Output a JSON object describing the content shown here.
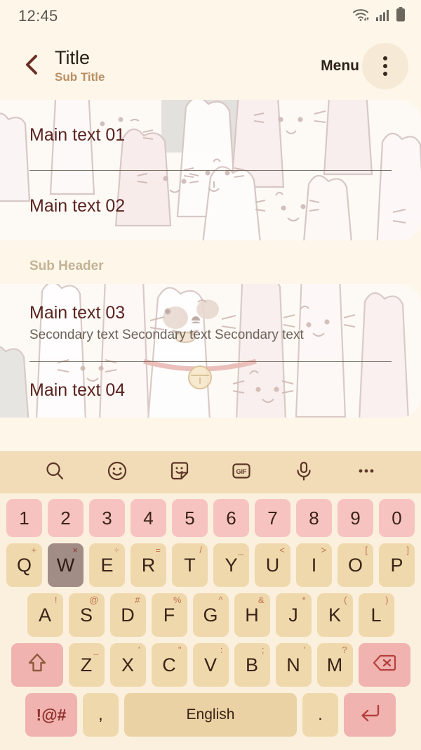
{
  "status_bar": {
    "time": "12:45",
    "icons": [
      "wifi-icon",
      "signal-icon",
      "battery-icon"
    ]
  },
  "app_bar": {
    "back_icon": "back-chevron-icon",
    "title": "Title",
    "subtitle": "Sub Title",
    "menu_label": "Menu",
    "overflow_icon": "overflow-menu-icon"
  },
  "content": {
    "card_one": {
      "rows": [
        {
          "main": "Main text 01"
        },
        {
          "main": "Main text 02"
        }
      ]
    },
    "sub_header": "Sub Header",
    "card_two": {
      "rows": [
        {
          "main": "Main text 03",
          "secondary": "Secondary text Secondary text Secondary text"
        },
        {
          "main": "Main text 04"
        }
      ]
    }
  },
  "keyboard": {
    "toolbar": [
      {
        "name": "search-icon",
        "label": ""
      },
      {
        "name": "emoji-icon",
        "label": ""
      },
      {
        "name": "sticker-icon",
        "label": ""
      },
      {
        "name": "gif-icon",
        "label": "GIF"
      },
      {
        "name": "microphone-icon",
        "label": ""
      },
      {
        "name": "more-options-icon",
        "label": ""
      }
    ],
    "rows": {
      "numbers": [
        "1",
        "2",
        "3",
        "4",
        "5",
        "6",
        "7",
        "8",
        "9",
        "0"
      ],
      "row_q": [
        {
          "key": "Q",
          "sup": "+"
        },
        {
          "key": "W",
          "sup": "×",
          "pressed": true
        },
        {
          "key": "E",
          "sup": "÷"
        },
        {
          "key": "R",
          "sup": "="
        },
        {
          "key": "T",
          "sup": "/"
        },
        {
          "key": "Y",
          "sup": "_"
        },
        {
          "key": "U",
          "sup": "<"
        },
        {
          "key": "I",
          "sup": ">"
        },
        {
          "key": "O",
          "sup": "["
        },
        {
          "key": "P",
          "sup": "]"
        }
      ],
      "row_a": [
        {
          "key": "A",
          "sup": "!"
        },
        {
          "key": "S",
          "sup": "@"
        },
        {
          "key": "D",
          "sup": "#"
        },
        {
          "key": "F",
          "sup": "%"
        },
        {
          "key": "G",
          "sup": "^"
        },
        {
          "key": "H",
          "sup": "&"
        },
        {
          "key": "J",
          "sup": "*"
        },
        {
          "key": "K",
          "sup": "("
        },
        {
          "key": "L",
          "sup": ")"
        }
      ],
      "row_z": [
        {
          "key": "Z",
          "sup": "_"
        },
        {
          "key": "X",
          "sup": "'"
        },
        {
          "key": "C",
          "sup": "\""
        },
        {
          "key": "V",
          "sup": ":"
        },
        {
          "key": "B",
          "sup": ";"
        },
        {
          "key": "N",
          "sup": "'"
        },
        {
          "key": "M",
          "sup": "?"
        }
      ],
      "shift_icon": "shift-icon",
      "backspace_icon": "backspace-icon",
      "symbols_label": "!@#",
      "comma_label": ",",
      "space_label": "English",
      "period_label": ".",
      "enter_icon": "enter-icon"
    }
  },
  "colors": {
    "page_bg": "#fdf6e9",
    "keyboard_bg": "#fbf0dd",
    "toolbar_bg": "#f2dcb8",
    "key_bg": "#efd9ac",
    "number_key_bg": "#f7c3c0",
    "accent_key_bg": "#f0b3b0",
    "pressed_key_bg": "#a18d86",
    "main_text": "#5a2420",
    "sub_title": "#bb8e63",
    "sub_header": "#c3b394"
  }
}
